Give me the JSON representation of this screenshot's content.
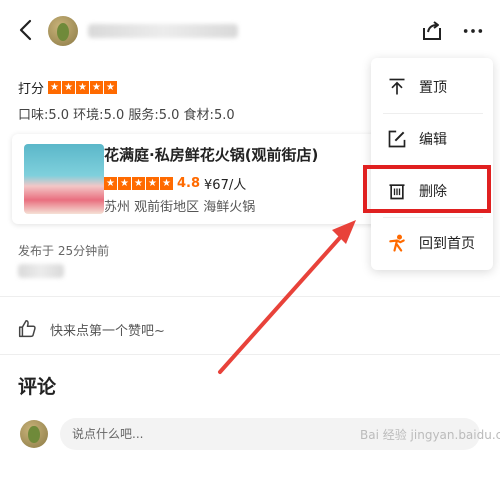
{
  "review": {
    "rating_label": "打分",
    "scores": "口味:5.0  环境:5.0  服务:5.0  食材:5.0",
    "posted_time": "发布于 25分钟前"
  },
  "shop": {
    "name": "花满庭·私房鲜花火锅(观前街店)",
    "score": "4.8",
    "price": "¥67/人",
    "location": "苏州 观前街地区 海鲜火锅"
  },
  "like": {
    "prompt": "快来点第一个赞吧~"
  },
  "comments": {
    "title": "评论",
    "placeholder": "说点什么吧..."
  },
  "menu": {
    "items": [
      {
        "label": "置顶",
        "icon": "pin-top-icon"
      },
      {
        "label": "编辑",
        "icon": "edit-icon"
      },
      {
        "label": "删除",
        "icon": "trash-icon"
      },
      {
        "label": "回到首页",
        "icon": "home-person-icon"
      }
    ]
  },
  "annotation": {
    "highlight_color": "#e02020",
    "accent_color": "#ff6a00"
  },
  "watermark": {
    "text": "Bai 经验 jingyan.baidu.com"
  }
}
